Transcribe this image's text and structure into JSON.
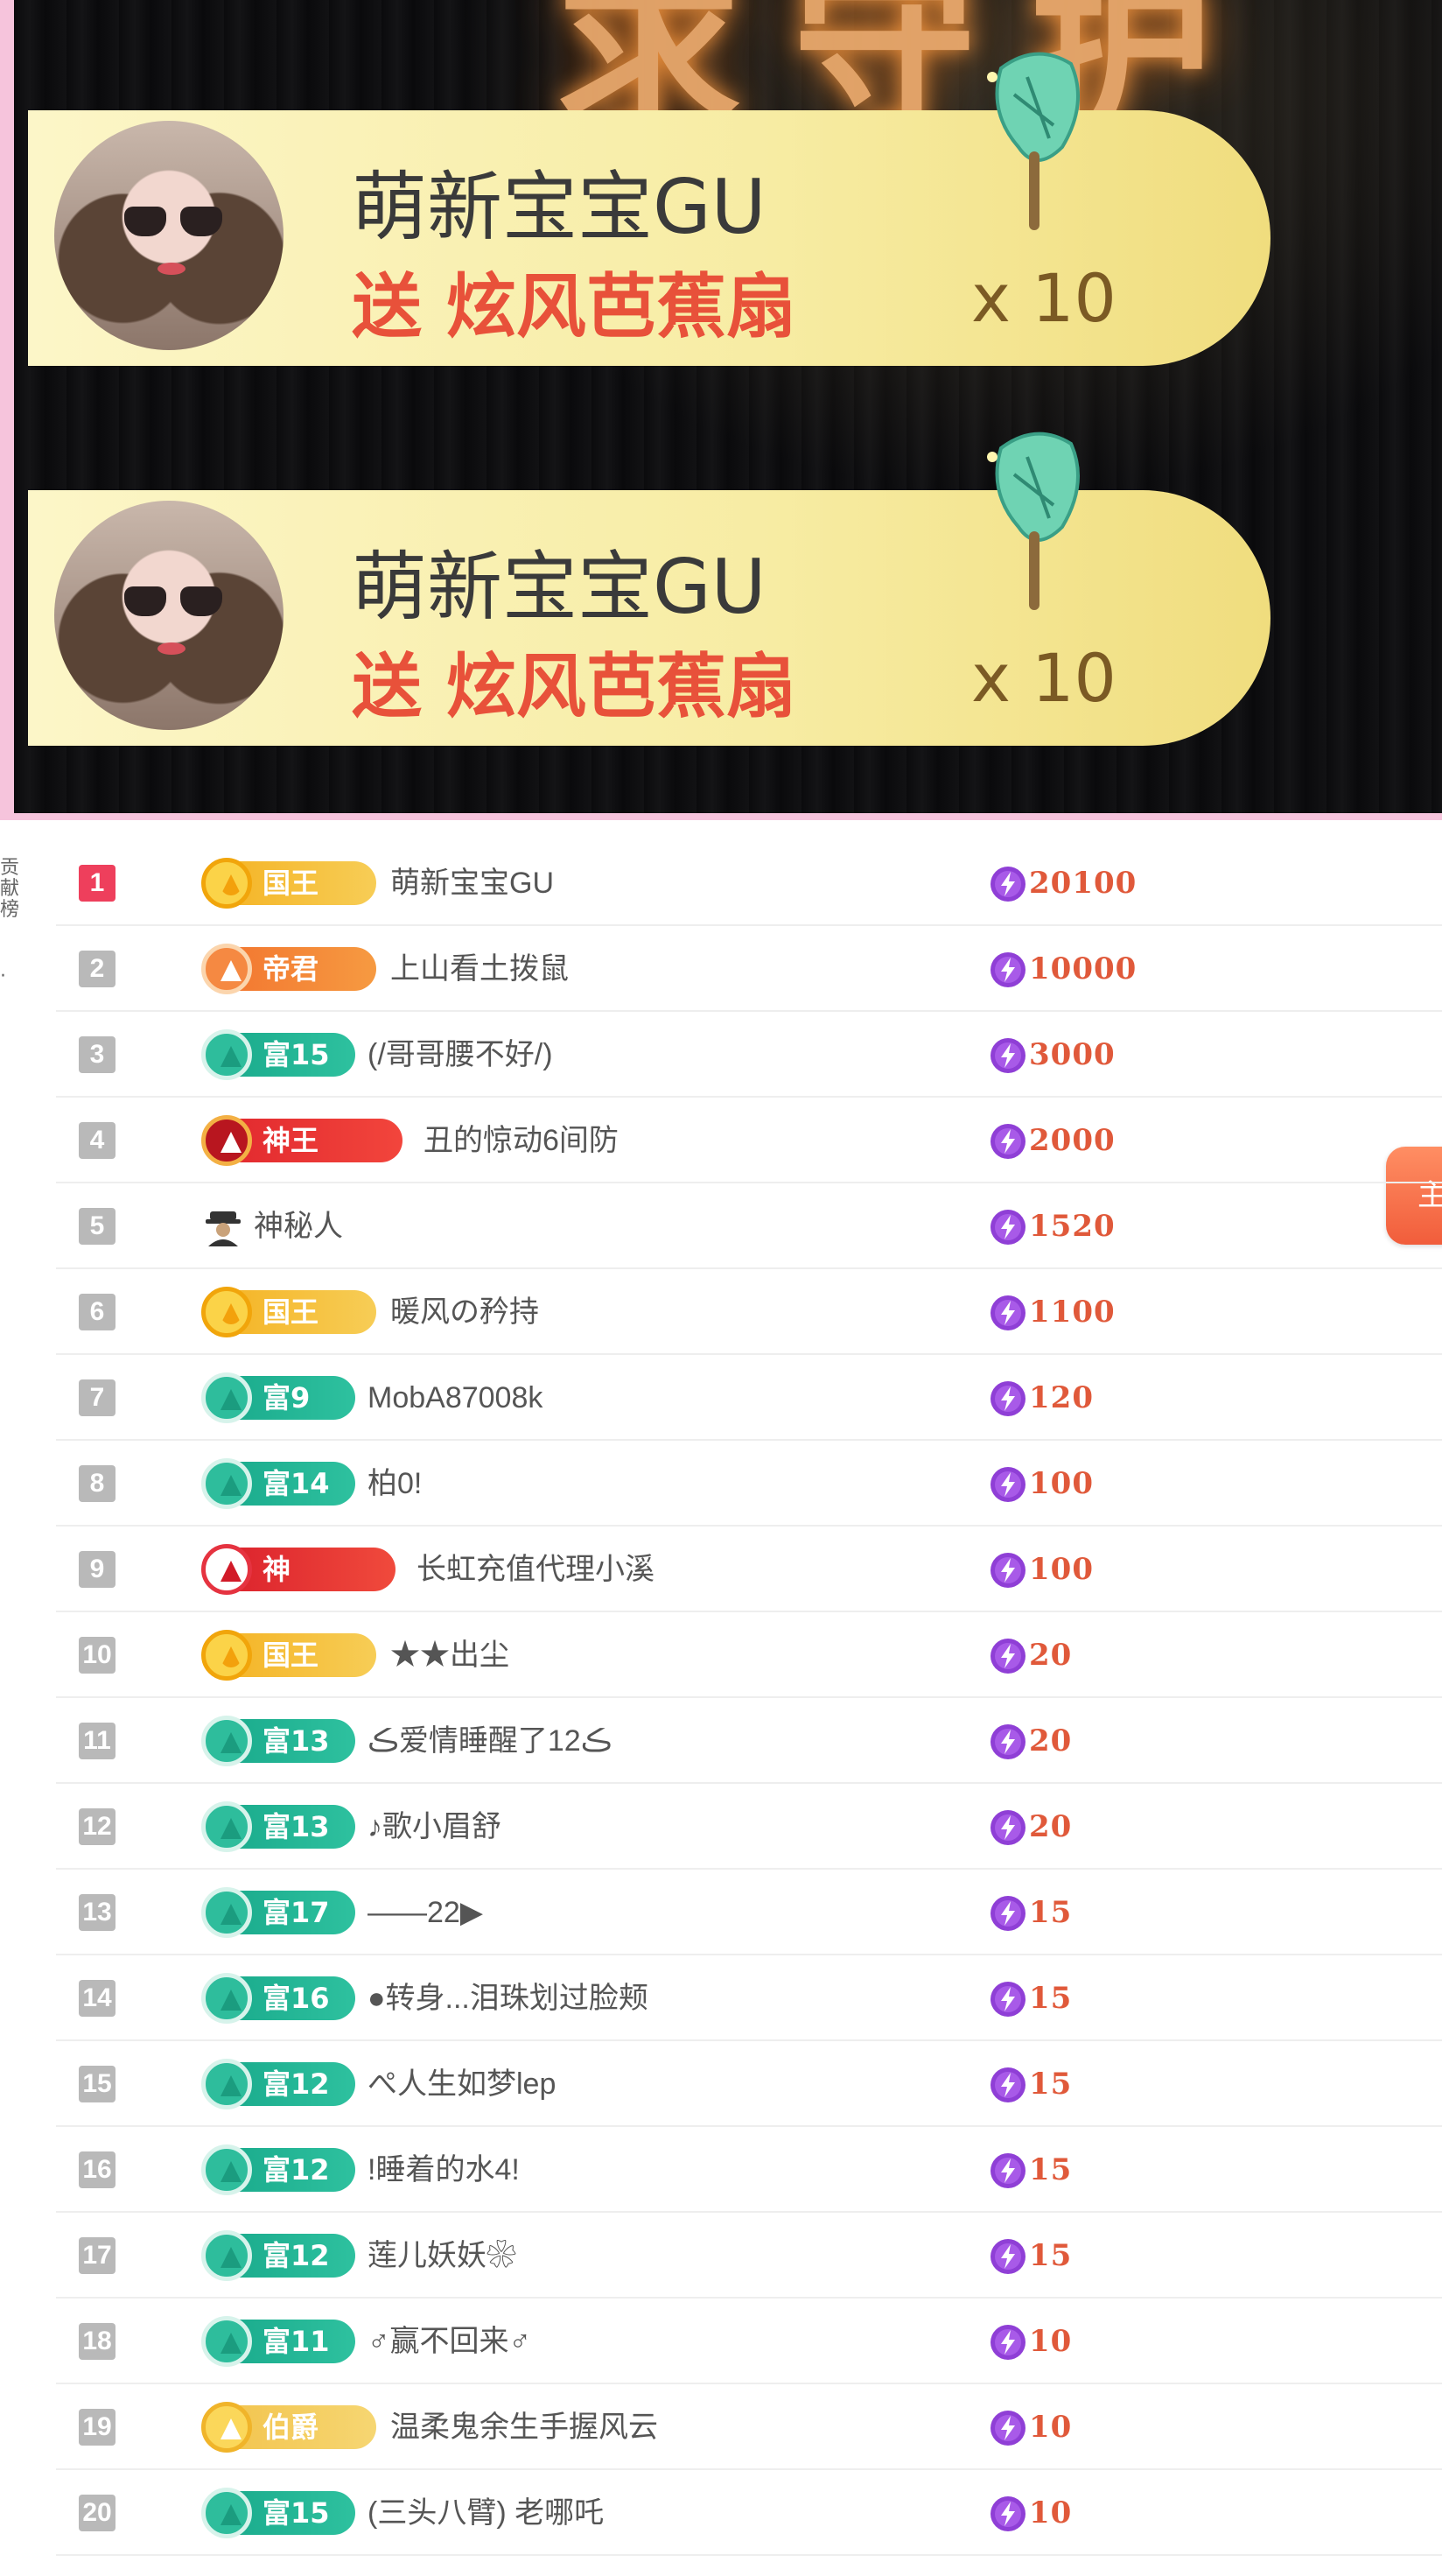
{
  "stream": {
    "title": "求守护",
    "gift_banners": [
      {
        "user": "萌新宝宝GU",
        "gift_text": "送 炫风芭蕉扇",
        "count": "x 10"
      },
      {
        "user": "萌新宝宝GU",
        "gift_text": "送 炫风芭蕉扇",
        "count": "x 10"
      }
    ]
  },
  "side_tab": {
    "label": "贡献榜",
    "dot": "·"
  },
  "float_button": {
    "label": "主"
  },
  "ranking": {
    "rows": [
      {
        "rank": "1",
        "badge": "国王",
        "badge_type": "king",
        "name": "萌新宝宝GU",
        "score": "20100"
      },
      {
        "rank": "2",
        "badge": "帝君",
        "badge_type": "emperor",
        "name": "上山看土拨鼠",
        "score": "10000"
      },
      {
        "rank": "3",
        "badge": "富15",
        "badge_type": "rich",
        "name": "(/哥哥腰不好/)",
        "score": "3000"
      },
      {
        "rank": "4",
        "badge": "神王",
        "badge_type": "godking",
        "name": "丑的惊动6间防",
        "score": "2000"
      },
      {
        "rank": "5",
        "badge": "",
        "badge_type": "mystery",
        "name": "神秘人",
        "score": "1520"
      },
      {
        "rank": "6",
        "badge": "国王",
        "badge_type": "king",
        "name": "暖风の矜持",
        "score": "1100"
      },
      {
        "rank": "7",
        "badge": "富9",
        "badge_type": "rich",
        "name": "MobA87008k",
        "score": "120"
      },
      {
        "rank": "8",
        "badge": "富14",
        "badge_type": "rich",
        "name": "柏0!",
        "score": "100"
      },
      {
        "rank": "9",
        "badge": "神",
        "badge_type": "god",
        "name": "长虹充值代理小溪",
        "score": "100"
      },
      {
        "rank": "10",
        "badge": "国王",
        "badge_type": "king",
        "name": "★★出尘",
        "score": "20"
      },
      {
        "rank": "11",
        "badge": "富13",
        "badge_type": "rich",
        "name": "ڪ爱情睡醒了12ڪ",
        "score": "20"
      },
      {
        "rank": "12",
        "badge": "富13",
        "badge_type": "rich",
        "name": "♪歌小眉舒",
        "score": "20"
      },
      {
        "rank": "13",
        "badge": "富17",
        "badge_type": "rich",
        "name": "——22▶",
        "score": "15"
      },
      {
        "rank": "14",
        "badge": "富16",
        "badge_type": "rich",
        "name": "●转身...泪珠划过脸颊",
        "score": "15"
      },
      {
        "rank": "15",
        "badge": "富12",
        "badge_type": "rich",
        "name": "ぺ人生如梦lep",
        "score": "15"
      },
      {
        "rank": "16",
        "badge": "富12",
        "badge_type": "rich",
        "name": "!睡着的水4!",
        "score": "15"
      },
      {
        "rank": "17",
        "badge": "富12",
        "badge_type": "rich",
        "name": "莲儿妖妖❀",
        "score": "15"
      },
      {
        "rank": "18",
        "badge": "富11",
        "badge_type": "rich",
        "name": "♂赢不回来♂",
        "score": "10"
      },
      {
        "rank": "19",
        "badge": "伯爵",
        "badge_type": "earl",
        "name": "温柔鬼余生手握风云",
        "score": "10"
      },
      {
        "rank": "20",
        "badge": "富15",
        "badge_type": "rich",
        "name": "(三头八臂) 老哪吒",
        "score": "10"
      }
    ]
  },
  "colors": {
    "accent_pink": "#f6c4dc",
    "score_orange": "#e0593a",
    "coin_purple": "#8f3fd6",
    "rank_top": "#ee3f5c",
    "rank_default": "#b9b9b9"
  },
  "icons": {
    "coin": "lightning-coin-icon",
    "mystery": "mystery-user-icon",
    "fan": "banana-fan-gift-icon"
  }
}
